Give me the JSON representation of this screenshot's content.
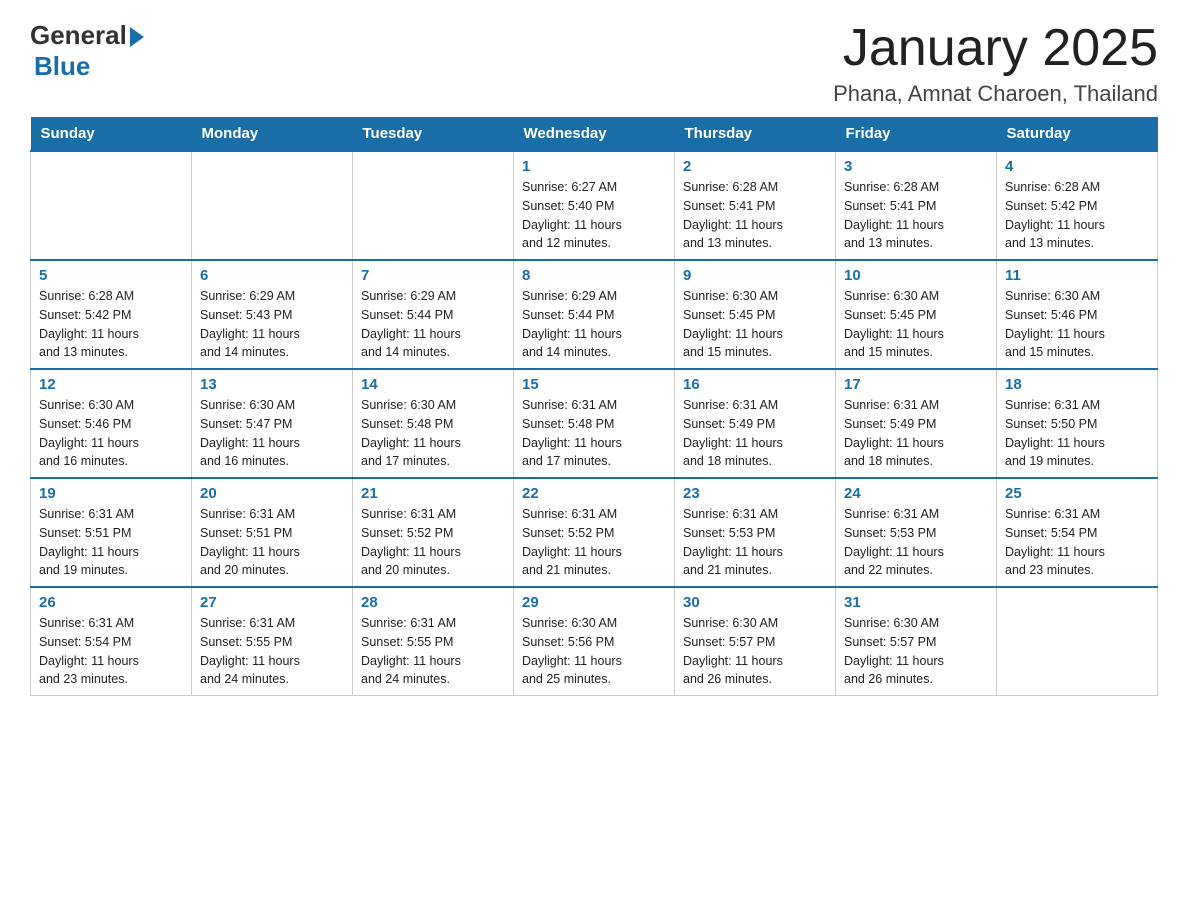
{
  "logo": {
    "general": "General",
    "blue": "Blue"
  },
  "title": "January 2025",
  "subtitle": "Phana, Amnat Charoen, Thailand",
  "days_of_week": [
    "Sunday",
    "Monday",
    "Tuesday",
    "Wednesday",
    "Thursday",
    "Friday",
    "Saturday"
  ],
  "weeks": [
    [
      {
        "day": "",
        "info": ""
      },
      {
        "day": "",
        "info": ""
      },
      {
        "day": "",
        "info": ""
      },
      {
        "day": "1",
        "info": "Sunrise: 6:27 AM\nSunset: 5:40 PM\nDaylight: 11 hours\nand 12 minutes."
      },
      {
        "day": "2",
        "info": "Sunrise: 6:28 AM\nSunset: 5:41 PM\nDaylight: 11 hours\nand 13 minutes."
      },
      {
        "day": "3",
        "info": "Sunrise: 6:28 AM\nSunset: 5:41 PM\nDaylight: 11 hours\nand 13 minutes."
      },
      {
        "day": "4",
        "info": "Sunrise: 6:28 AM\nSunset: 5:42 PM\nDaylight: 11 hours\nand 13 minutes."
      }
    ],
    [
      {
        "day": "5",
        "info": "Sunrise: 6:28 AM\nSunset: 5:42 PM\nDaylight: 11 hours\nand 13 minutes."
      },
      {
        "day": "6",
        "info": "Sunrise: 6:29 AM\nSunset: 5:43 PM\nDaylight: 11 hours\nand 14 minutes."
      },
      {
        "day": "7",
        "info": "Sunrise: 6:29 AM\nSunset: 5:44 PM\nDaylight: 11 hours\nand 14 minutes."
      },
      {
        "day": "8",
        "info": "Sunrise: 6:29 AM\nSunset: 5:44 PM\nDaylight: 11 hours\nand 14 minutes."
      },
      {
        "day": "9",
        "info": "Sunrise: 6:30 AM\nSunset: 5:45 PM\nDaylight: 11 hours\nand 15 minutes."
      },
      {
        "day": "10",
        "info": "Sunrise: 6:30 AM\nSunset: 5:45 PM\nDaylight: 11 hours\nand 15 minutes."
      },
      {
        "day": "11",
        "info": "Sunrise: 6:30 AM\nSunset: 5:46 PM\nDaylight: 11 hours\nand 15 minutes."
      }
    ],
    [
      {
        "day": "12",
        "info": "Sunrise: 6:30 AM\nSunset: 5:46 PM\nDaylight: 11 hours\nand 16 minutes."
      },
      {
        "day": "13",
        "info": "Sunrise: 6:30 AM\nSunset: 5:47 PM\nDaylight: 11 hours\nand 16 minutes."
      },
      {
        "day": "14",
        "info": "Sunrise: 6:30 AM\nSunset: 5:48 PM\nDaylight: 11 hours\nand 17 minutes."
      },
      {
        "day": "15",
        "info": "Sunrise: 6:31 AM\nSunset: 5:48 PM\nDaylight: 11 hours\nand 17 minutes."
      },
      {
        "day": "16",
        "info": "Sunrise: 6:31 AM\nSunset: 5:49 PM\nDaylight: 11 hours\nand 18 minutes."
      },
      {
        "day": "17",
        "info": "Sunrise: 6:31 AM\nSunset: 5:49 PM\nDaylight: 11 hours\nand 18 minutes."
      },
      {
        "day": "18",
        "info": "Sunrise: 6:31 AM\nSunset: 5:50 PM\nDaylight: 11 hours\nand 19 minutes."
      }
    ],
    [
      {
        "day": "19",
        "info": "Sunrise: 6:31 AM\nSunset: 5:51 PM\nDaylight: 11 hours\nand 19 minutes."
      },
      {
        "day": "20",
        "info": "Sunrise: 6:31 AM\nSunset: 5:51 PM\nDaylight: 11 hours\nand 20 minutes."
      },
      {
        "day": "21",
        "info": "Sunrise: 6:31 AM\nSunset: 5:52 PM\nDaylight: 11 hours\nand 20 minutes."
      },
      {
        "day": "22",
        "info": "Sunrise: 6:31 AM\nSunset: 5:52 PM\nDaylight: 11 hours\nand 21 minutes."
      },
      {
        "day": "23",
        "info": "Sunrise: 6:31 AM\nSunset: 5:53 PM\nDaylight: 11 hours\nand 21 minutes."
      },
      {
        "day": "24",
        "info": "Sunrise: 6:31 AM\nSunset: 5:53 PM\nDaylight: 11 hours\nand 22 minutes."
      },
      {
        "day": "25",
        "info": "Sunrise: 6:31 AM\nSunset: 5:54 PM\nDaylight: 11 hours\nand 23 minutes."
      }
    ],
    [
      {
        "day": "26",
        "info": "Sunrise: 6:31 AM\nSunset: 5:54 PM\nDaylight: 11 hours\nand 23 minutes."
      },
      {
        "day": "27",
        "info": "Sunrise: 6:31 AM\nSunset: 5:55 PM\nDaylight: 11 hours\nand 24 minutes."
      },
      {
        "day": "28",
        "info": "Sunrise: 6:31 AM\nSunset: 5:55 PM\nDaylight: 11 hours\nand 24 minutes."
      },
      {
        "day": "29",
        "info": "Sunrise: 6:30 AM\nSunset: 5:56 PM\nDaylight: 11 hours\nand 25 minutes."
      },
      {
        "day": "30",
        "info": "Sunrise: 6:30 AM\nSunset: 5:57 PM\nDaylight: 11 hours\nand 26 minutes."
      },
      {
        "day": "31",
        "info": "Sunrise: 6:30 AM\nSunset: 5:57 PM\nDaylight: 11 hours\nand 26 minutes."
      },
      {
        "day": "",
        "info": ""
      }
    ]
  ]
}
